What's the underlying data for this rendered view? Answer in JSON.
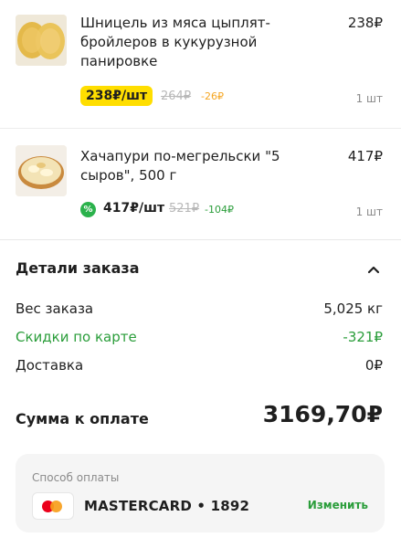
{
  "items": [
    {
      "title": "Шницель из мяса цыплят-бройлеров в кукурузной панировке",
      "total": "238₽",
      "price": "238₽/шт",
      "old_price": "264₽",
      "discount": "-26₽",
      "qty": "1 шт"
    },
    {
      "title": "Хачапури по-мегрельски \"5 сыров\", 500 г",
      "total": "417₽",
      "price": "417₽/шт",
      "old_price": "521₽",
      "discount": "-104₽",
      "qty": "1 шт",
      "badge_icon": "%"
    }
  ],
  "details": {
    "title": "Детали заказа",
    "rows": [
      {
        "label": "Вес заказа",
        "value": "5,025 кг"
      },
      {
        "label": "Скидки по карте",
        "value": "-321₽"
      },
      {
        "label": "Доставка",
        "value": "0₽"
      }
    ],
    "total_label": "Сумма к оплате",
    "total_value": "3169,70₽"
  },
  "payment": {
    "label": "Способ оплаты",
    "card": "MASTERCARD • 1892",
    "change": "Изменить"
  },
  "colors": {
    "accent_yellow": "#ffde00",
    "accent_green": "#2a9d3a",
    "discount_orange": "#f5a623",
    "mastercard_red": "#eb001b",
    "mastercard_orange": "#f79e1b"
  }
}
